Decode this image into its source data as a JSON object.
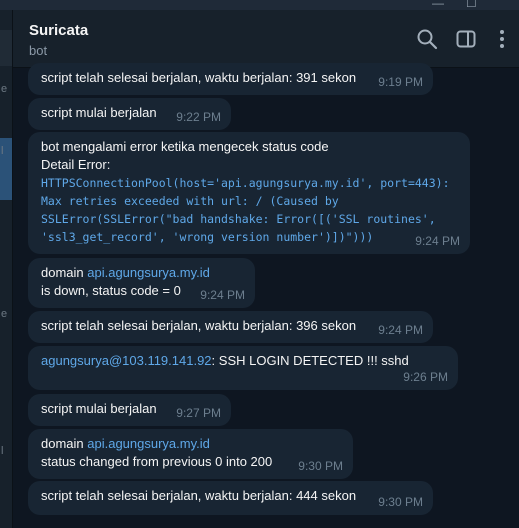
{
  "window": {
    "minimize": "—",
    "maximize": "☐"
  },
  "header": {
    "title": "Suricata",
    "subtitle": "bot"
  },
  "messages": [
    {
      "text": "script telah selesai berjalan, waktu berjalan:  391 sekon",
      "time": "9:19 PM"
    },
    {
      "text": "script mulai berjalan",
      "time": "9:22 PM"
    },
    {
      "title": "bot mengalami error ketika mengecek status code",
      "detail_label": "Detail Error:",
      "code_lines": [
        "HTTPSConnectionPool(host='api.agungsurya.my.id', port=443):",
        "Max retries exceeded with url: / (Caused by",
        "SSLError(SSLError(\"bad handshake: Error([('SSL routines',",
        "'ssl3_get_record', 'wrong version number')])\")))"
      ],
      "time": "9:24 PM"
    },
    {
      "prefix": "domain ",
      "link": "api.agungsurya.my.id",
      "line2": " is down, status code = 0",
      "time": "9:24 PM"
    },
    {
      "text": "script telah selesai berjalan, waktu berjalan:  396 sekon",
      "time": "9:24 PM"
    },
    {
      "link": "agungsurya@103.119.141.92",
      "text": ": SSH LOGIN DETECTED !!! sshd",
      "time": "9:26 PM"
    },
    {
      "text": "script mulai berjalan",
      "time": "9:27 PM"
    },
    {
      "prefix": "domain ",
      "link": "api.agungsurya.my.id",
      "line2": " status changed from previous 0 into 200",
      "time": "9:30 PM"
    },
    {
      "text": "script telah selesai berjalan, waktu berjalan:  444 sekon",
      "time": "9:30 PM"
    }
  ],
  "left_strip": {
    "marks": [
      "e",
      "l",
      "e",
      "l"
    ]
  },
  "icons": {
    "search": "search-icon",
    "sidebar": "sidebar-toggle-icon",
    "menu": "more-vertical-icon"
  },
  "colors": {
    "background": "#0e1621",
    "bubble": "#182533",
    "header": "#17212b",
    "link": "#5fa8e8",
    "time": "#6d7f8f"
  }
}
